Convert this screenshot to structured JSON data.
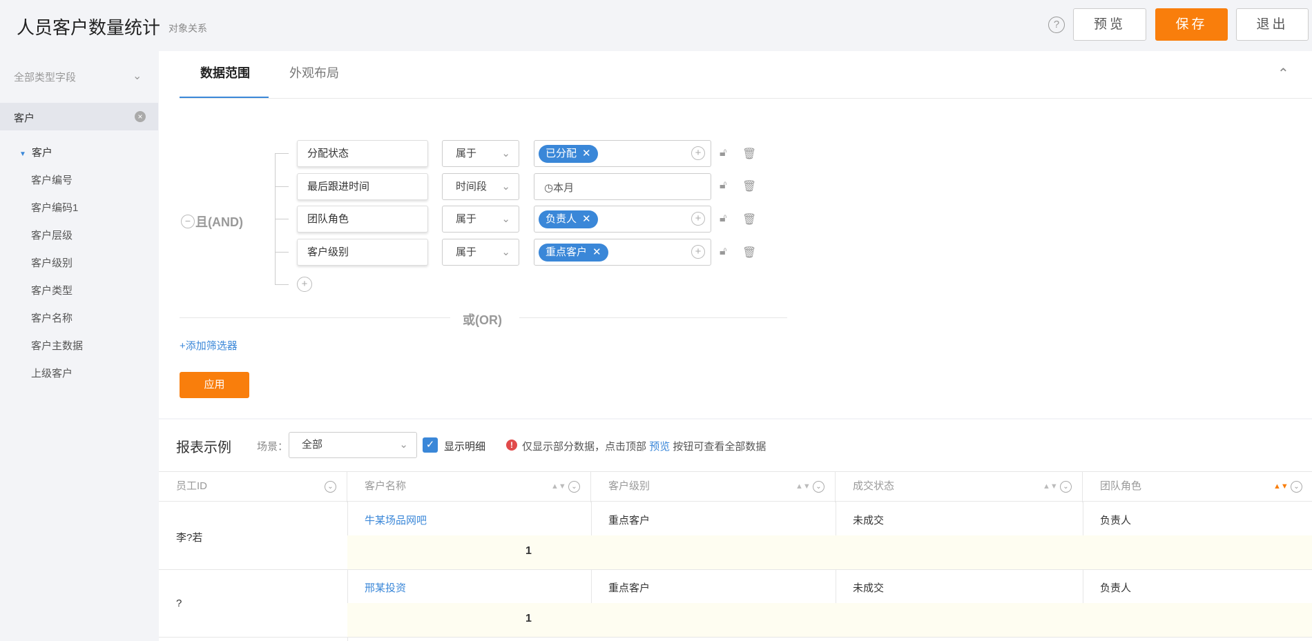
{
  "header": {
    "title": "人员客户数量统计",
    "subtitle": "对象关系",
    "help": "?",
    "preview": "预览",
    "save": "保存",
    "exit": "退出"
  },
  "sidebar": {
    "filter_label": "全部类型字段",
    "selected": "客户",
    "tree_root": "客户",
    "items": [
      "客户编号",
      "客户编码1",
      "客户层级",
      "客户级别",
      "客户类型",
      "客户名称",
      "客户主数据",
      "上级客户"
    ]
  },
  "tabs": [
    "数据范围",
    "外观布局"
  ],
  "filter": {
    "logic": "且(AND)",
    "conditions": [
      {
        "field": "分配状态",
        "op": "属于",
        "tag": "已分配"
      },
      {
        "field": "最后跟进时间",
        "op": "时间段",
        "text": "本月"
      },
      {
        "field": "团队角色",
        "op": "属于",
        "tag": "负责人"
      },
      {
        "field": "客户级别",
        "op": "属于",
        "tag": "重点客户"
      }
    ],
    "or_label": "或(OR)",
    "add_filter": "+添加筛选器",
    "apply": "应用"
  },
  "report": {
    "title": "报表示例",
    "scene_label": "场景：",
    "scene_value": "全部",
    "show_detail": "显示明细",
    "notice_pre": "仅显示部分数据，点击顶部",
    "notice_link": "预览",
    "notice_post": "按钮可查看全部数据",
    "columns": [
      "员工ID",
      "客户名称",
      "客户级别",
      "成交状态",
      "团队角色"
    ],
    "rows": [
      {
        "employee": "李?若",
        "customer": "牛某场品网吧",
        "level": "重点客户",
        "deal": "未成交",
        "role": "负责人",
        "subtotal": "1"
      },
      {
        "employee": "?",
        "customer": "邢某投资",
        "level": "重点客户",
        "deal": "未成交",
        "role": "负责人",
        "subtotal": "1"
      }
    ]
  }
}
